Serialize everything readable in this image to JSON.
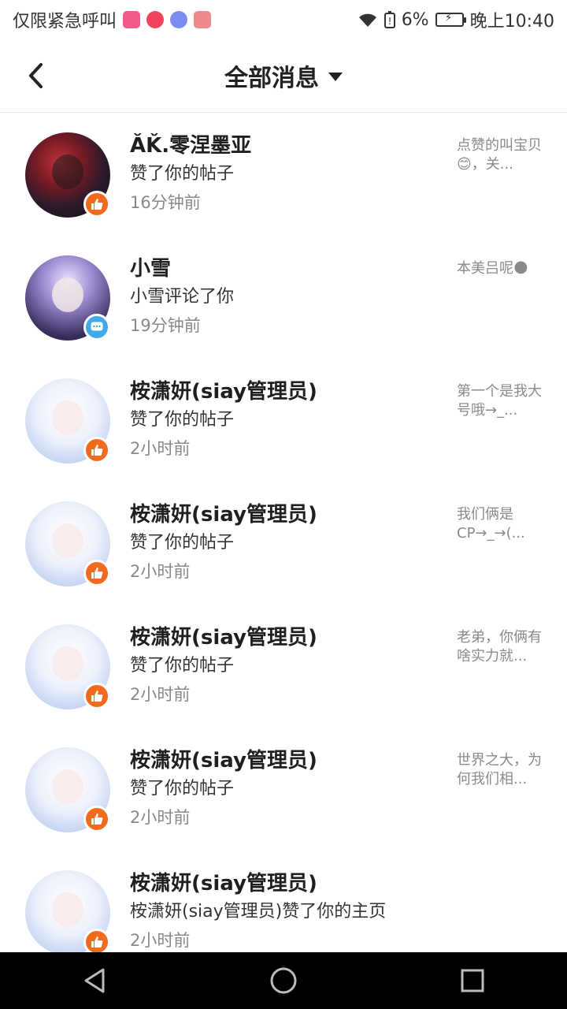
{
  "status_bar": {
    "left_text": "仅限紧急呼叫",
    "battery_percent": "6%",
    "time": "晚上10:40",
    "app_icon_colors": [
      "#f25a8a",
      "#f0445a",
      "#7b8cf0",
      "#f08a8a"
    ]
  },
  "header": {
    "title": "全部消息"
  },
  "messages": [
    {
      "name": "ǍǨ.零涅墨亚",
      "action": "赞了你的帖子",
      "time": "16分钟前",
      "preview": "点赞的叫宝贝😊，关...",
      "badge": "like",
      "avatar": "dark"
    },
    {
      "name": "小雪",
      "action": "小雪评论了你",
      "time": "19分钟前",
      "preview": "本美吕呢🌑",
      "badge": "comment",
      "avatar": "purple"
    },
    {
      "name": "桉潇妍(siay管理员)",
      "action": "赞了你的帖子",
      "time": "2小时前",
      "preview": "第一个是我大号哦→_...",
      "badge": "like",
      "avatar": "light"
    },
    {
      "name": "桉潇妍(siay管理员)",
      "action": "赞了你的帖子",
      "time": "2小时前",
      "preview": "我们俩是CP→_→(...",
      "badge": "like",
      "avatar": "light"
    },
    {
      "name": "桉潇妍(siay管理员)",
      "action": "赞了你的帖子",
      "time": "2小时前",
      "preview": "老弟，你俩有啥实力就...",
      "badge": "like",
      "avatar": "light"
    },
    {
      "name": "桉潇妍(siay管理员)",
      "action": "赞了你的帖子",
      "time": "2小时前",
      "preview": "世界之大，为何我们相...",
      "badge": "like",
      "avatar": "light"
    },
    {
      "name": "桉潇妍(siay管理员)",
      "action": "桉潇妍(siay管理员)赞了你的主页",
      "time": "2小时前",
      "preview": "",
      "badge": "like",
      "avatar": "light"
    }
  ]
}
